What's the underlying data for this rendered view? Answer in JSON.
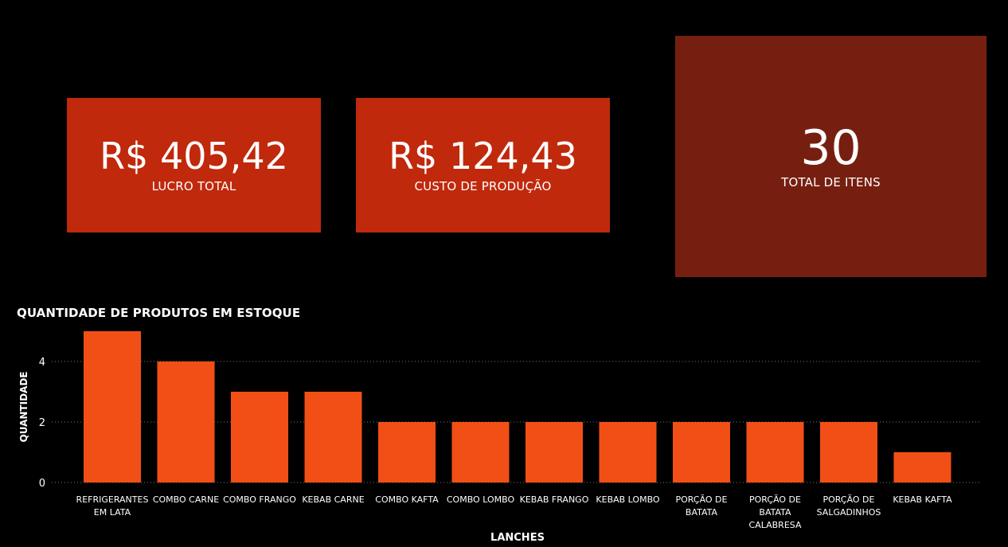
{
  "kpis": {
    "lucro": {
      "value": "R$ 405,42",
      "label": "LUCRO TOTAL"
    },
    "custo": {
      "value": "R$ 124,43",
      "label": "CUSTO DE PRODUÇÃO"
    },
    "itens": {
      "value": "30",
      "label": "TOTAL DE ITENS"
    }
  },
  "colors": {
    "card_primary": "#c0290c",
    "card_dark": "#761f10",
    "bar": "#f24f17",
    "background": "#000000"
  },
  "chart_data": {
    "type": "bar",
    "title": "QUANTIDADE DE PRODUTOS EM ESTOQUE",
    "xlabel": "LANCHES",
    "ylabel": "QUANTIDADE",
    "categories": [
      "REFRIGERANTES EM LATA",
      "COMBO CARNE",
      "COMBO FRANGO",
      "KEBAB CARNE",
      "COMBO KAFTA",
      "COMBO LOMBO",
      "KEBAB FRANGO",
      "KEBAB LOMBO",
      "PORÇÃO DE BATATA",
      "PORÇÃO DE BATATA CALABRESA",
      "PORÇÃO DE SALGADINHOS",
      "KEBAB KAFTA"
    ],
    "values": [
      5,
      4,
      3,
      3,
      2,
      2,
      2,
      2,
      2,
      2,
      2,
      1
    ],
    "yticks": [
      0,
      2,
      4
    ],
    "ylim": [
      0,
      5
    ],
    "grid": true
  }
}
